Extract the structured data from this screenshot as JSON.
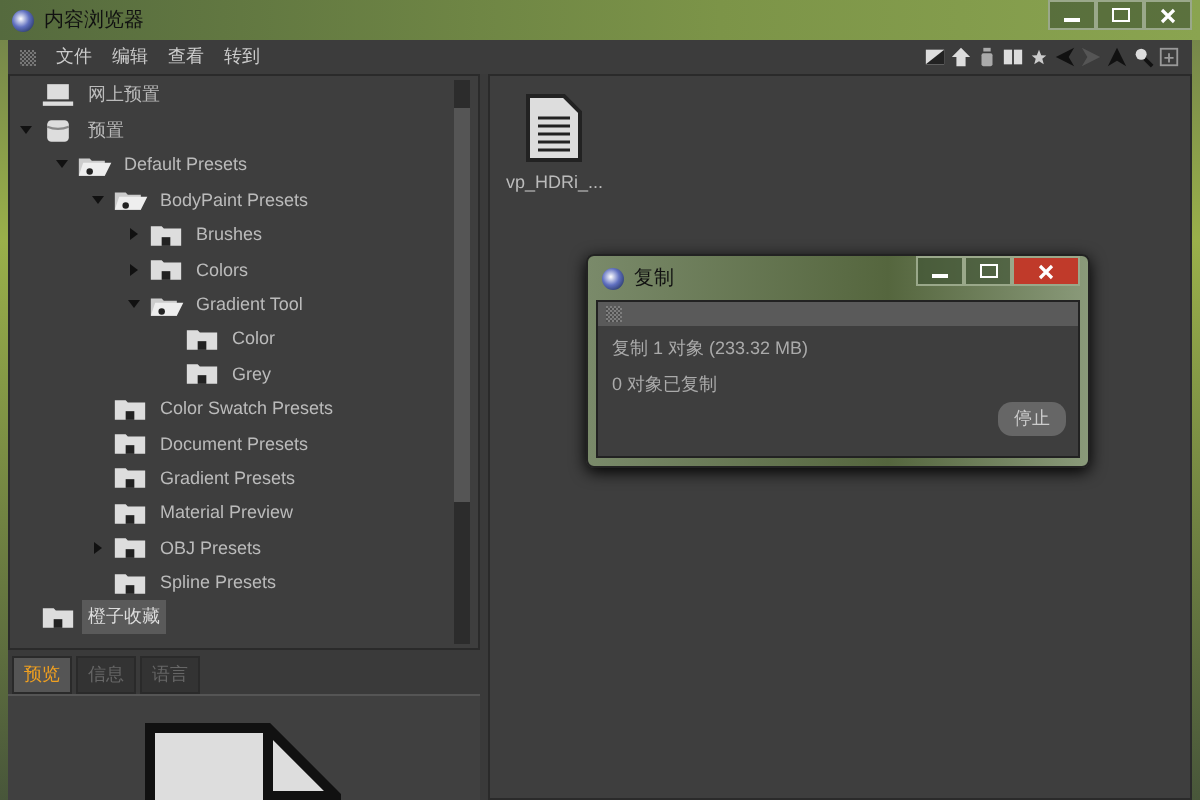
{
  "window": {
    "title": "内容浏览器"
  },
  "menu": [
    "文件",
    "编辑",
    "查看",
    "转到"
  ],
  "tree": [
    {
      "label": "网上预置",
      "kind": "network",
      "selected": false
    },
    {
      "label": "预置",
      "kind": "database",
      "expanded": true,
      "selected": false,
      "children": [
        {
          "label": "Default Presets",
          "kind": "folder",
          "expanded": true,
          "selected": false,
          "children": [
            {
              "label": "BodyPaint Presets",
              "kind": "folder",
              "expanded": true,
              "selected": false,
              "children": [
                {
                  "label": "Brushes",
                  "kind": "folder",
                  "expanded": false,
                  "selected": false
                },
                {
                  "label": "Colors",
                  "kind": "folder",
                  "expanded": false,
                  "selected": false
                },
                {
                  "label": "Gradient Tool",
                  "kind": "folder",
                  "expanded": true,
                  "selected": false,
                  "children": [
                    {
                      "label": "Color",
                      "kind": "folder",
                      "selected": false
                    },
                    {
                      "label": "Grey",
                      "kind": "folder",
                      "selected": false
                    }
                  ]
                }
              ]
            },
            {
              "label": "Color Swatch Presets",
              "kind": "folder",
              "selected": false
            },
            {
              "label": "Document Presets",
              "kind": "folder",
              "selected": false
            },
            {
              "label": "Gradient Presets",
              "kind": "folder",
              "selected": false
            },
            {
              "label": "Material Preview",
              "kind": "folder",
              "selected": false
            },
            {
              "label": "OBJ Presets",
              "kind": "folder",
              "expanded": false,
              "selected": false
            },
            {
              "label": "Spline Presets",
              "kind": "folder",
              "selected": false
            }
          ]
        }
      ]
    },
    {
      "label": "橙子收藏",
      "kind": "folder",
      "selected": true
    }
  ],
  "tabs": [
    {
      "label": "预览",
      "selected": true
    },
    {
      "label": "信息",
      "selected": false
    },
    {
      "label": "语言",
      "selected": false
    }
  ],
  "files": [
    {
      "name": "vp_HDRi_..."
    }
  ],
  "dialog": {
    "title": "复制",
    "line_1": "复制 1 对象 (233.32 MB)",
    "line_2": "0 对象已复制",
    "button": "停止"
  }
}
